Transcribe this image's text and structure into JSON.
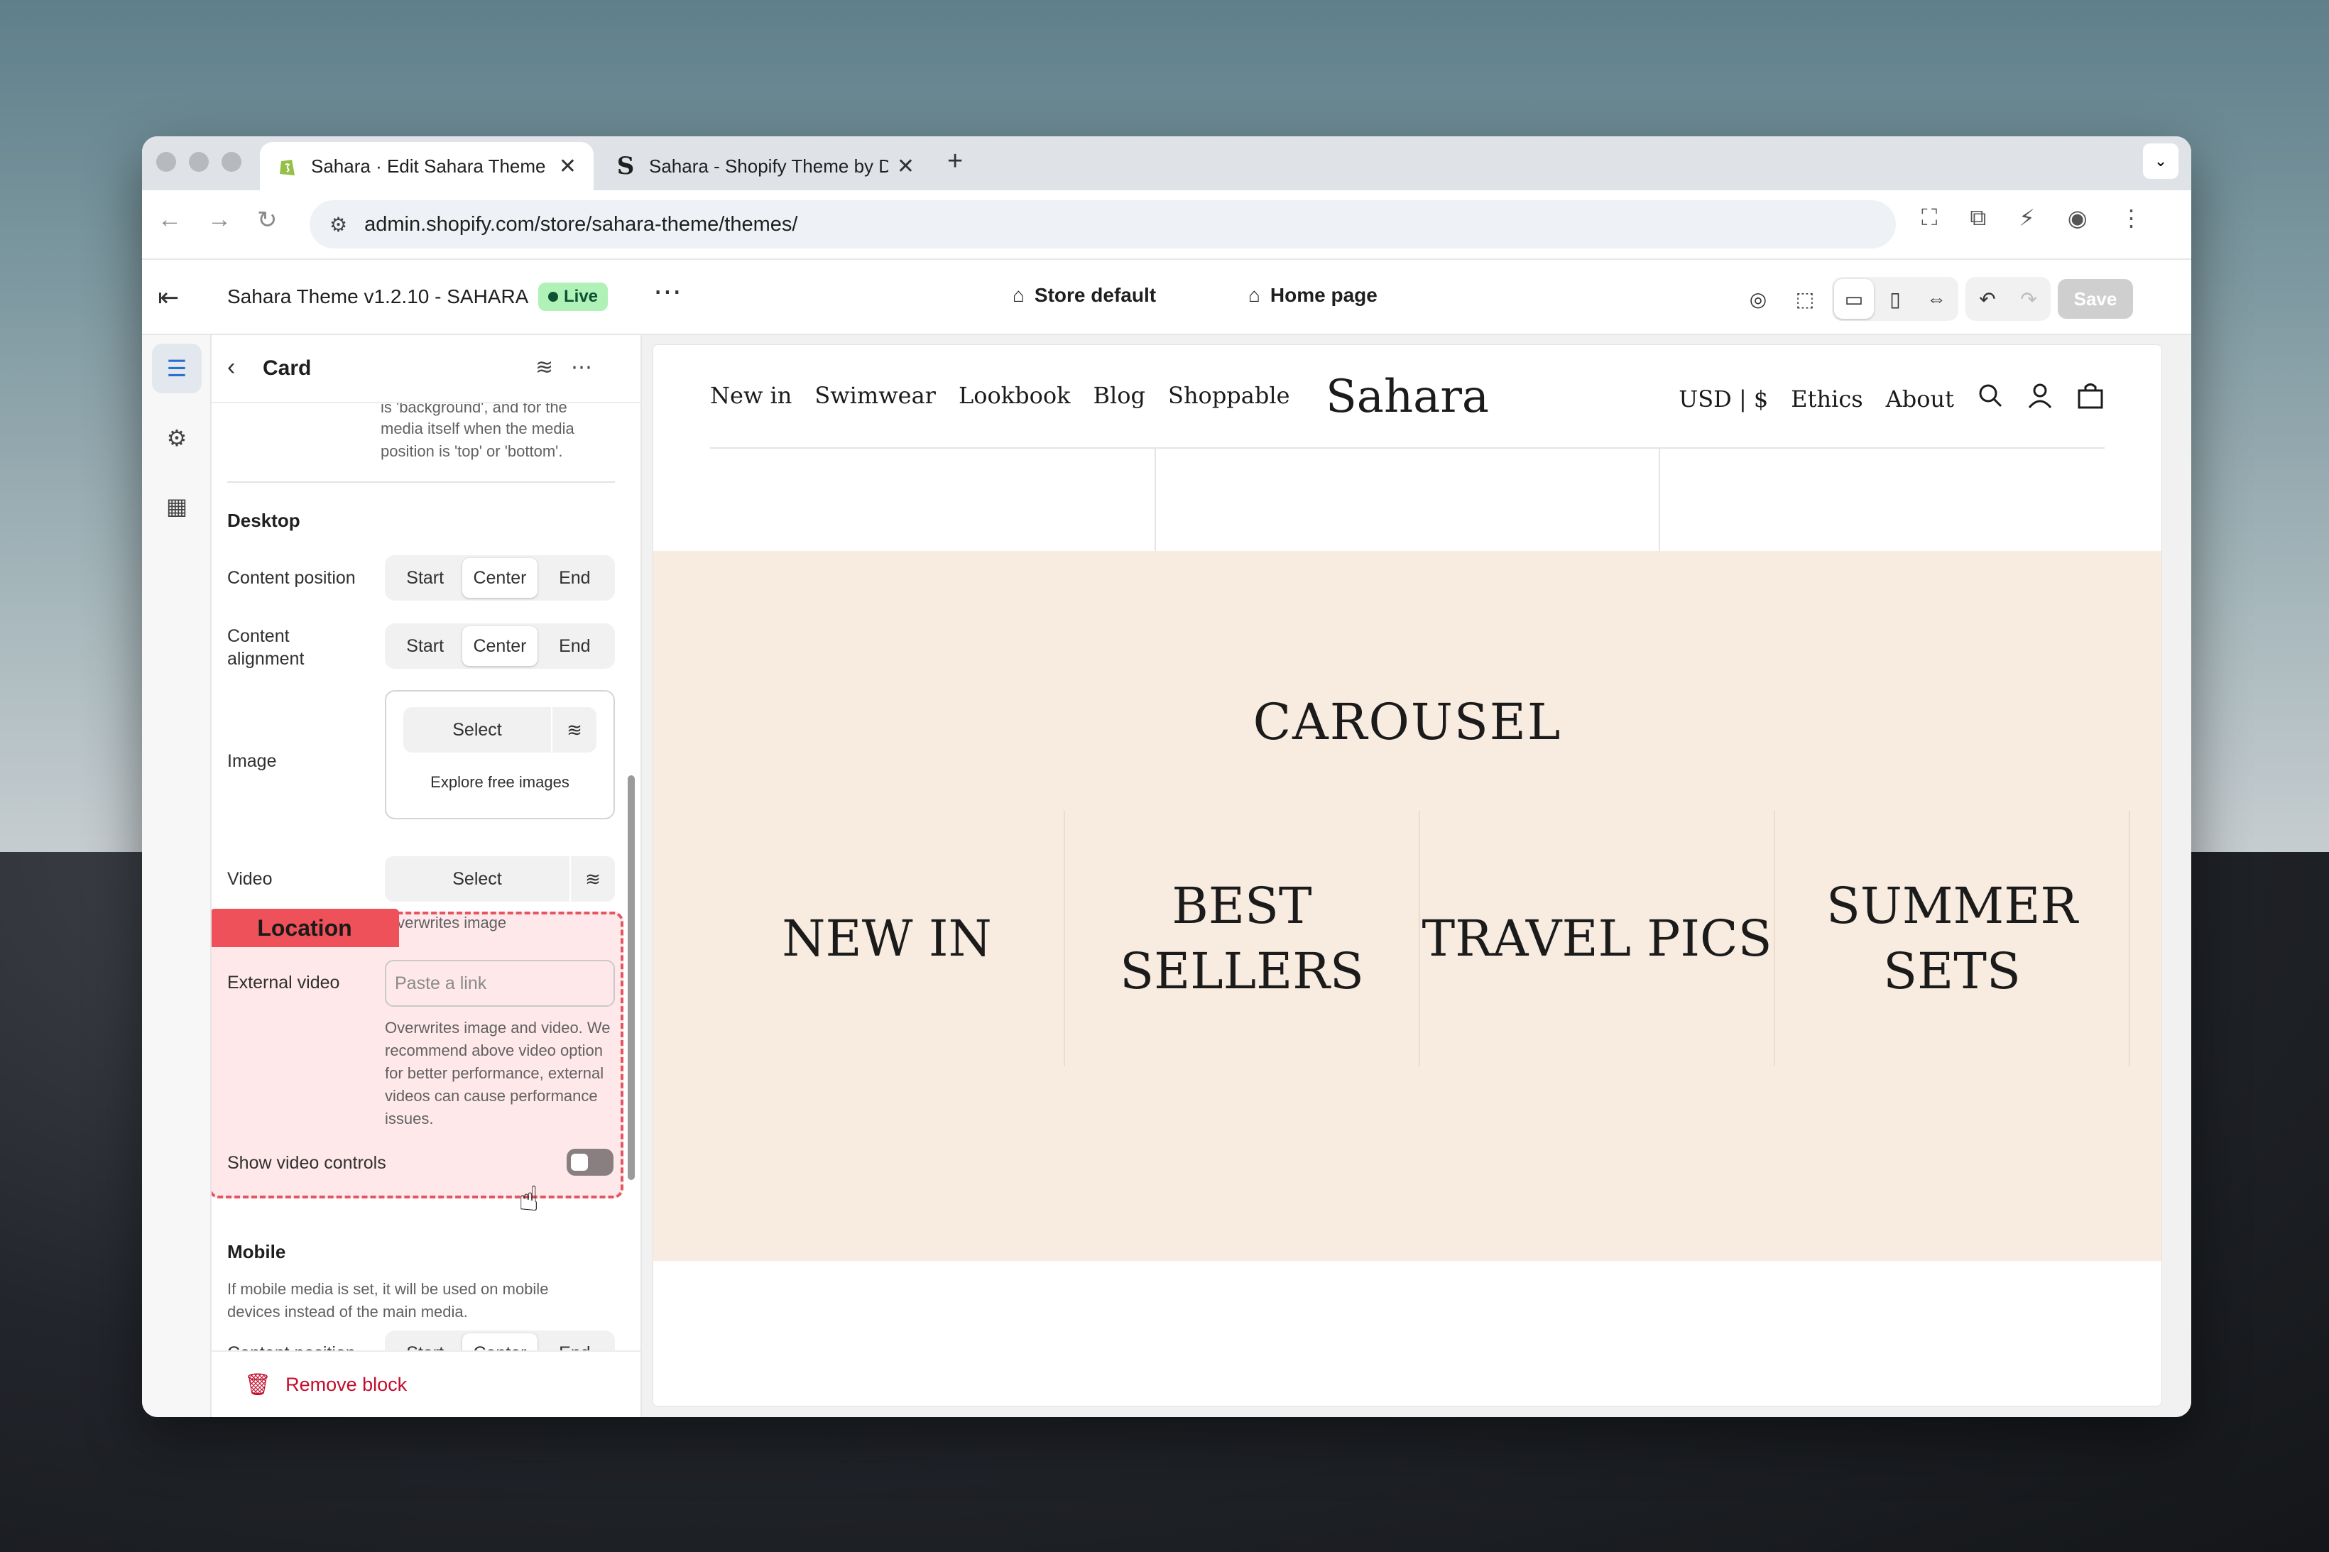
{
  "browser": {
    "tabs": [
      {
        "title": "Sahara · Edit Sahara Theme v",
        "favicon": "shopify-icon"
      },
      {
        "title": "Sahara - Shopify Theme by D",
        "favicon": "S"
      }
    ],
    "url": "admin.shopify.com/store/sahara-theme/themes/"
  },
  "app_header": {
    "theme_name": "Sahara Theme v1.2.10 - SAHARA",
    "status": "Live",
    "context": "Store default",
    "page": "Home page",
    "save_label": "Save"
  },
  "panel": {
    "title": "Card",
    "intro_text_top": "is 'background', and for the",
    "intro_text_rest": "media itself when the media position is 'top' or 'bottom'.",
    "desktop_heading": "Desktop",
    "content_position": {
      "label": "Content position",
      "options": [
        "Start",
        "Center",
        "End"
      ],
      "selected": "Center"
    },
    "content_alignment": {
      "label": "Content alignment",
      "options": [
        "Start",
        "Center",
        "End"
      ],
      "selected": "Center"
    },
    "image": {
      "label": "Image",
      "select": "Select",
      "explore": "Explore free images"
    },
    "video": {
      "label": "Video",
      "select": "Select",
      "help": "Overwrites image"
    },
    "external_video": {
      "label": "External video",
      "placeholder": "Paste a link",
      "help": "Overwrites image and video. We recommend above video option for better performance, external videos can cause performance issues."
    },
    "show_video_controls": {
      "label": "Show video controls",
      "value": false
    },
    "highlight_label": "Location",
    "mobile_heading": "Mobile",
    "mobile_help": "If mobile media is set, it will be used on mobile devices instead of the main media.",
    "mobile_content_position": {
      "label": "Content position",
      "options": [
        "Start",
        "Center",
        "End"
      ],
      "selected": "Center"
    },
    "remove_block": "Remove block"
  },
  "storefront": {
    "nav_left": [
      "New in",
      "Swimwear",
      "Lookbook",
      "Blog",
      "Shoppable"
    ],
    "logo": "Sahara",
    "nav_right": [
      "USD | $",
      "Ethics",
      "About"
    ],
    "carousel_title": "CAROUSEL",
    "cards": [
      "NEW IN",
      "BEST SELLERS",
      "TRAVEL PICS",
      "SUMMER SETS"
    ]
  },
  "colors": {
    "highlight": "#ee5159",
    "carousel_bg": "#f8ebdf",
    "live_badge": "#aff1b6",
    "remove": "#c10d2c"
  }
}
